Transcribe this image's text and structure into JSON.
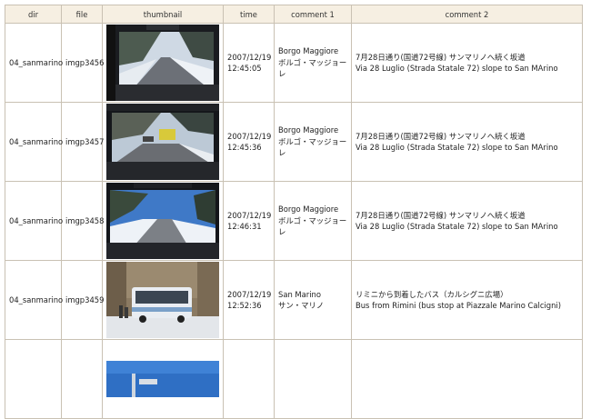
{
  "columns": {
    "dir": "dir",
    "file": "file",
    "thumbnail": "thumbnail",
    "time": "time",
    "comment1": "comment 1",
    "comment2": "comment 2"
  },
  "rows": [
    {
      "dir": "04_sanmarino",
      "file": "imgp3456",
      "date": "2007/12/19",
      "time": "12:45:05",
      "place_en": "Borgo Maggiore",
      "place_ja": "ボルゴ・マッジョーレ",
      "comment_ja": "7月28日通り(国道72号線) サンマリノへ続く坂道",
      "comment_en": "Via 28 Luglio (Strada Statale 72) slope to San MArino"
    },
    {
      "dir": "04_sanmarino",
      "file": "imgp3457",
      "date": "2007/12/19",
      "time": "12:45:36",
      "place_en": "Borgo Maggiore",
      "place_ja": "ボルゴ・マッジョーレ",
      "comment_ja": "7月28日通り(国道72号線) サンマリノへ続く坂道",
      "comment_en": "Via 28 Luglio (Strada Statale 72) slope to San MArino"
    },
    {
      "dir": "04_sanmarino",
      "file": "imgp3458",
      "date": "2007/12/19",
      "time": "12:46:31",
      "place_en": "Borgo Maggiore",
      "place_ja": "ボルゴ・マッジョーレ",
      "comment_ja": "7月28日通り(国道72号線) サンマリノへ続く坂道",
      "comment_en": "Via 28 Luglio (Strada Statale 72) slope to San MArino"
    },
    {
      "dir": "04_sanmarino",
      "file": "imgp3459",
      "date": "2007/12/19",
      "time": "12:52:36",
      "place_en": "San Marino",
      "place_ja": "サン・マリノ",
      "comment_ja": "リミニから到着したバス（カルシグニ広場）",
      "comment_en": "Bus from Rimini (bus stop at Piazzale Marino Calcigni)"
    }
  ]
}
